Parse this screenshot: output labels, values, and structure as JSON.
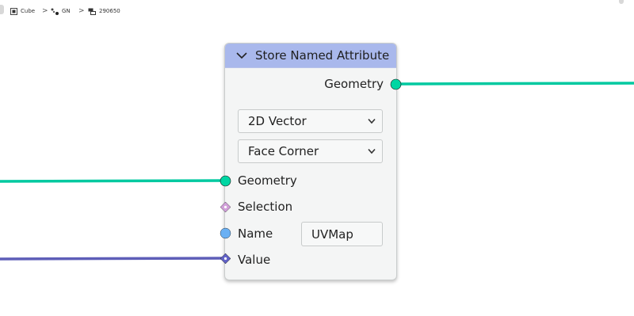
{
  "breadcrumb": {
    "items": [
      {
        "label": "Cube",
        "icon": "object-icon"
      },
      {
        "label": "GN",
        "icon": "geometry-nodes-icon"
      },
      {
        "label": "290650",
        "icon": "node-tree-icon"
      }
    ],
    "separator": ">"
  },
  "node": {
    "title": "Store Named Attribute",
    "output_label": "Geometry",
    "data_type": "2D Vector",
    "domain": "Face Corner",
    "inputs": {
      "geometry": "Geometry",
      "selection": "Selection",
      "name": "Name",
      "name_value": "UVMap",
      "value": "Value"
    }
  },
  "colors": {
    "header": "#a9b8ec",
    "geometry_socket": "#00d6a3",
    "selection_socket": "#d1a0d9",
    "name_socket": "#6ab0f3",
    "value_socket": "#6363c7",
    "geometry_link": "#00c9a0",
    "value_link": "#5e5eb8"
  }
}
